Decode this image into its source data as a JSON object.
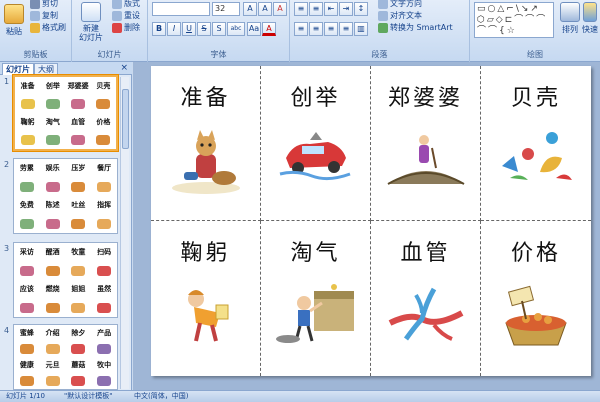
{
  "ribbon": {
    "clipboard": {
      "paste": "粘贴",
      "cut": "剪切",
      "copy": "复制",
      "format_painter": "格式刷",
      "label": "剪贴板"
    },
    "slides": {
      "new_slide": "新建\n幻灯片",
      "layout": "版式",
      "reset": "重设",
      "delete": "删除",
      "label": "幻灯片"
    },
    "font": {
      "font_name": "",
      "font_size": "32",
      "grow": "A",
      "shrink": "A",
      "clear": "A",
      "bold": "B",
      "italic": "I",
      "underline": "U",
      "strike": "S",
      "shadow": "S",
      "spacing": "abc",
      "case": "Aa",
      "color": "A",
      "label": "字体"
    },
    "paragraph": {
      "text_direction": "文字方向",
      "align_text": "对齐文本",
      "convert_smartart": "转换为 SmartArt",
      "label": "段落"
    },
    "drawing": {
      "arrange": "排列",
      "quick_styles": "快速",
      "label": "绘图"
    }
  },
  "panel": {
    "tab_slides": "幻灯片",
    "tab_outline": "大纲",
    "close": "×",
    "thumbs": [
      {
        "num": "1",
        "selected": true,
        "words": [
          "准备",
          "创举",
          "郑婆婆",
          "贝壳",
          "",
          "",
          "",
          "",
          "鞠躬",
          "淘气",
          "血管",
          "价格",
          "",
          "",
          "",
          ""
        ]
      },
      {
        "num": "2",
        "selected": false,
        "words": [
          "劳累",
          "娱乐",
          "压岁",
          "餐厅",
          "",
          "",
          "",
          "",
          "免费",
          "陈述",
          "吐丝",
          "指挥",
          "",
          "",
          "",
          ""
        ]
      },
      {
        "num": "3",
        "selected": false,
        "words": [
          "采访",
          "醒酒",
          "牧童",
          "扫码",
          "",
          "",
          "",
          "",
          "应该",
          "燃烧",
          "姐姐",
          "虽然",
          "",
          "",
          "",
          ""
        ]
      },
      {
        "num": "4",
        "selected": false,
        "words": [
          "蜜蜂",
          "介绍",
          "除夕",
          "产品",
          "",
          "",
          "",
          "",
          "健康",
          "元旦",
          "蘑菇",
          "牧中",
          "",
          "",
          "",
          ""
        ]
      }
    ]
  },
  "slide": {
    "cards": [
      {
        "word": "准备",
        "pic": "boy-cat-basket"
      },
      {
        "word": "创举",
        "pic": "flying-car"
      },
      {
        "word": "郑婆婆",
        "pic": "old-woman-bridge"
      },
      {
        "word": "贝壳",
        "pic": "shells"
      },
      {
        "word": "鞠躬",
        "pic": "bowing-girl"
      },
      {
        "word": "淘气",
        "pic": "naughty-boy"
      },
      {
        "word": "血管",
        "pic": "blood-vessels"
      },
      {
        "word": "价格",
        "pic": "price-basket"
      }
    ]
  },
  "status": {
    "slide_count": "幻灯片 1/10",
    "theme": "\"默认设计模板\"",
    "language": "中文(简体，中国)"
  },
  "colors": {
    "selected_border": "#f2b14c",
    "ribbon_bg": "#dbe7f6",
    "slide_bg": "#9fb6d6"
  }
}
